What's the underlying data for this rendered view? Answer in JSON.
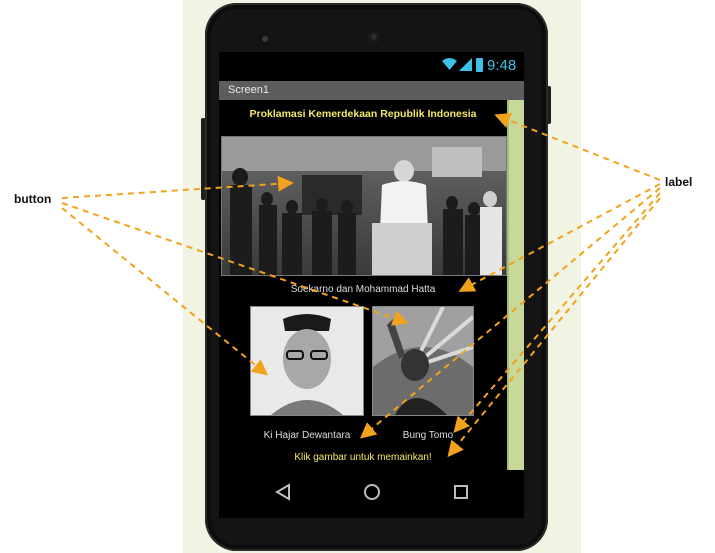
{
  "status_bar": {
    "time": "9:48"
  },
  "screen": {
    "title": "Screen1",
    "label_title": "Proklamasi Kemerdekaan Republik Indonesia",
    "caption_main": "Soekarno dan Mohammad Hatta",
    "caption_left": "Ki Hajar Dewantara",
    "caption_right": "Bung Tomo",
    "hint": "Klik gambar untuk memainkan!"
  },
  "annotations": {
    "button": "button",
    "label": "label"
  },
  "colors": {
    "accent_yellow": "#f3e86a",
    "status_blue": "#3ec1e6",
    "arrow_orange": "#f2a31b",
    "scroll_green": "#c6d99b"
  },
  "icons": [
    "wifi-icon",
    "signal-icon",
    "battery-icon",
    "back-icon",
    "home-icon",
    "recents-icon"
  ]
}
